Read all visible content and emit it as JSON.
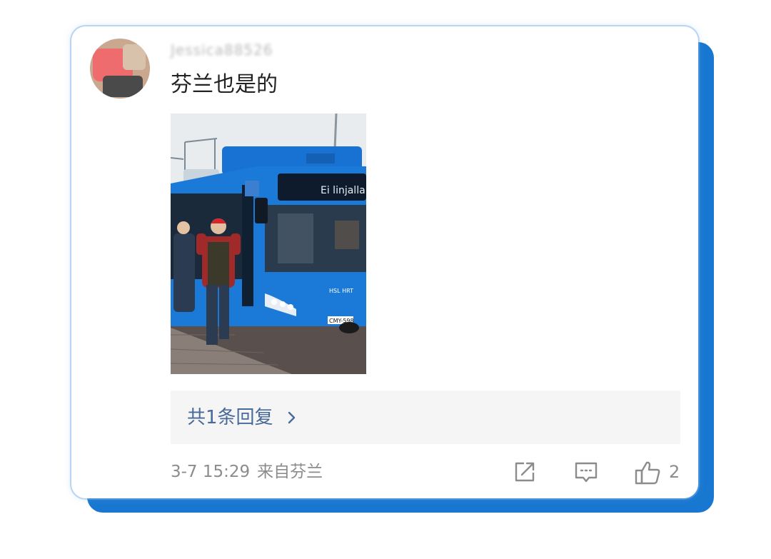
{
  "comment": {
    "username": "Jessica88526",
    "text": "芬兰也是的",
    "photo": {
      "bus_display": "Ei linjalla",
      "plate": "CMY-598",
      "logo_text": "HSL HRT"
    },
    "replies_label": "共1条回复",
    "timestamp": "3-7 15:29",
    "source": "来自芬兰",
    "like_count": "2"
  },
  "icons": {
    "share": "share-icon",
    "comment": "comment-icon",
    "like": "thumbs-up-icon",
    "chevron": "chevron-right-icon"
  },
  "colors": {
    "accent_blue": "#1877d0",
    "link_blue": "#486a9a",
    "meta_gray": "#8c8c8c"
  }
}
